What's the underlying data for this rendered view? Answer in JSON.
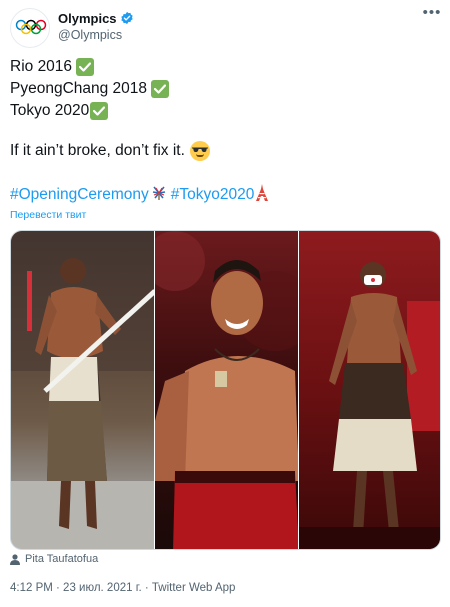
{
  "account": {
    "display_name": "Olympics",
    "handle": "@Olympics",
    "avatar_icon": "olympic-rings-icon",
    "verified_icon": "verified-badge-icon"
  },
  "tweet": {
    "lines": [
      "Rio 2016",
      "PyeongChang 2018",
      "Tokyo 2020"
    ],
    "check_icon": "check-mark-button-emoji",
    "closing": "If it ain’t broke, don’t fix it.",
    "closing_emoji": "smiling-face-with-sunglasses-emoji",
    "hashtag1": "#OpeningCeremony",
    "hashtag1_emoji": "opening-ceremony-flag-emoji",
    "hashtag2": "#Tokyo2020",
    "hashtag2_emoji": "tokyo-tower-emoji",
    "translate": "Перевести твит"
  },
  "media": {
    "tagged_person": "Pita Taufatofua",
    "person_icon": "person-icon"
  },
  "meta": {
    "timestamp": "4:12 PM · 23 июл. 2021 г. · Twitter Web App"
  },
  "colors": {
    "link": "#1d9bf0",
    "text": "#0f1419",
    "muted": "#536471",
    "check_green": "#77b255",
    "verified_blue": "#1d9bf0"
  }
}
